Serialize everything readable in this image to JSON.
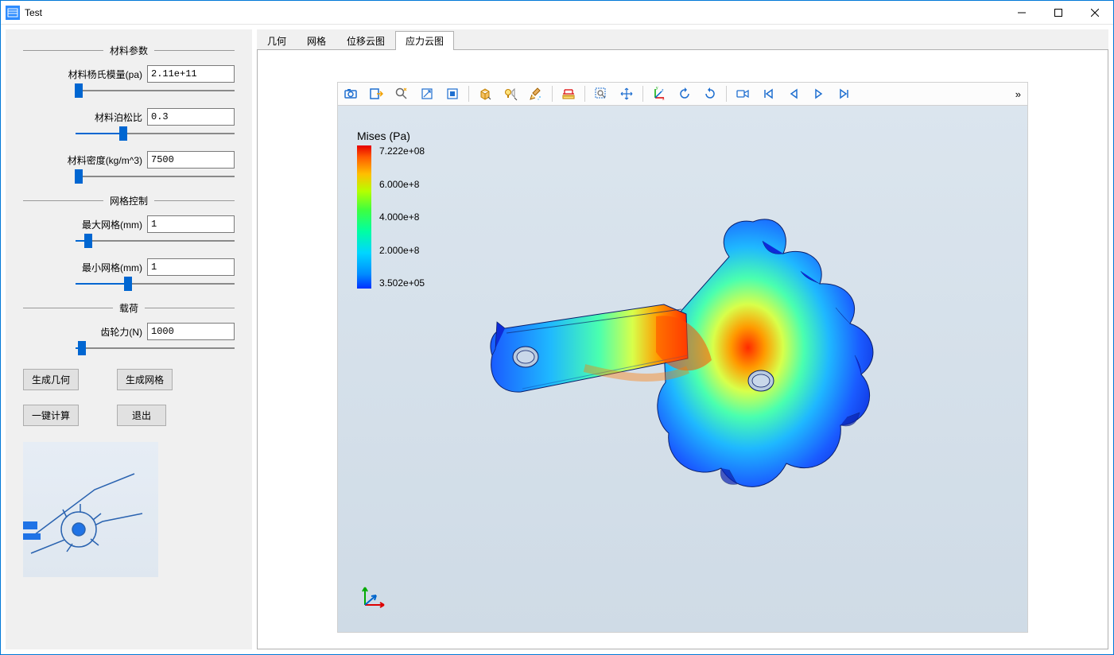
{
  "window": {
    "title": "Test"
  },
  "sidebar": {
    "sections": {
      "material": {
        "title": "材料参数"
      },
      "mesh": {
        "title": "网格控制"
      },
      "load": {
        "title": "载荷"
      }
    },
    "fields": {
      "modulus": {
        "label": "材料杨氏模量(pa)",
        "value": "2.11e+11",
        "sliderPos": 2
      },
      "poisson": {
        "label": "材料泊松比",
        "value": "0.3",
        "sliderPos": 30
      },
      "density": {
        "label": "材料密度(kg/m^3)",
        "value": "7500",
        "sliderPos": 2
      },
      "maxMesh": {
        "label": "最大网格(mm)",
        "value": "1",
        "sliderPos": 8
      },
      "minMesh": {
        "label": "最小网格(mm)",
        "value": "1",
        "sliderPos": 33
      },
      "force": {
        "label": "齿轮力(N)",
        "value": "1000",
        "sliderPos": 4
      }
    },
    "buttons": {
      "genGeom": "生成几何",
      "genMesh": "生成网格",
      "compute": "一键计算",
      "exit": "退出"
    }
  },
  "tabs": {
    "geometry": "几何",
    "mesh": "网格",
    "displacement": "位移云图",
    "stress": "应力云图"
  },
  "viewer": {
    "legend": {
      "title": "Mises (Pa)",
      "max": "7.222e+08",
      "t1": "6.000e+8",
      "t2": "4.000e+8",
      "t3": "2.000e+8",
      "min": "3.502e+05"
    },
    "overflow": "»"
  },
  "toolbar": {
    "camera": "camera",
    "export": "export",
    "zoom": "zoom",
    "resize": "resize",
    "fit": "fit",
    "box_color": "box-color",
    "lightbulb": "lightbulb",
    "clean": "clean",
    "ruler": "ruler",
    "select_box": "select-box",
    "move": "move",
    "axes": "axes",
    "rotate_cw": "rotate-cw",
    "rotate_ccw": "rotate-ccw",
    "record": "record",
    "first": "first",
    "prev": "prev",
    "play": "play",
    "next": "next"
  },
  "chart_data": {
    "type": "contour-legend",
    "title": "Mises (Pa)",
    "min": 350200,
    "max": 722200000,
    "ticks": [
      722200000,
      600000000,
      400000000,
      200000000,
      350200
    ],
    "colormap": "jet",
    "unit": "Pa"
  }
}
